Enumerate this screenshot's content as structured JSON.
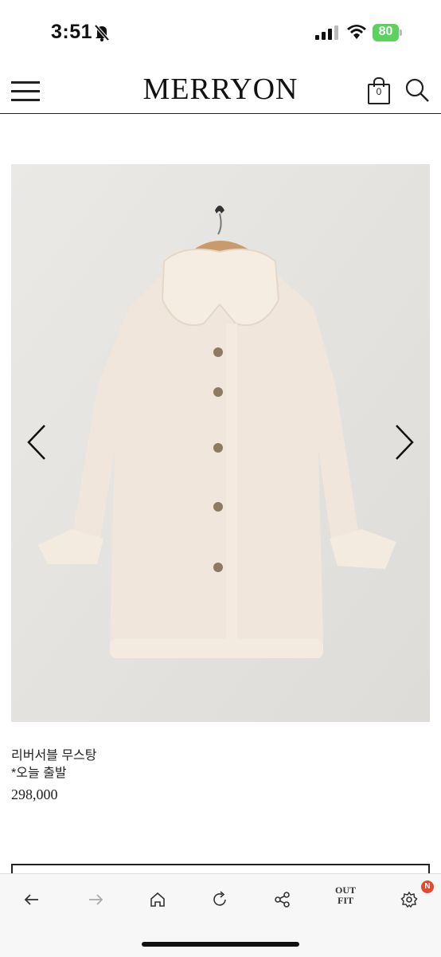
{
  "status_bar": {
    "time": "3:51",
    "battery": "80"
  },
  "header": {
    "logo": "MERRYON",
    "cart_count": "0"
  },
  "product": {
    "name": "리버서블 무스탕",
    "subtitle": "*오늘 출발",
    "price": "298,000"
  },
  "toolbar": {
    "outfit_line1": "OUT",
    "outfit_line2": "FIT",
    "badge": "N"
  },
  "icons": {
    "menu": "hamburger-icon",
    "cart": "shopping-bag-icon",
    "search": "search-icon",
    "prev": "chevron-left-icon",
    "next": "chevron-right-icon",
    "back": "arrow-left-icon",
    "forward": "arrow-right-icon",
    "home": "home-icon",
    "reload": "reload-icon",
    "share": "share-icon",
    "settings": "gear-icon"
  }
}
